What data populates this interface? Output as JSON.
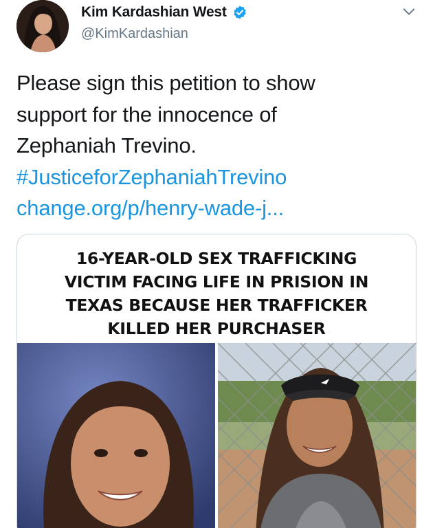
{
  "user": {
    "display_name": "Kim Kardashian West",
    "handle": "@KimKardashian",
    "verified": true,
    "avatar_icon": "profile-photo"
  },
  "tweet": {
    "lines": [
      "Please sign this petition to show",
      "support for the innocence of",
      "Zephaniah Trevino."
    ],
    "hashtag": "#JusticeforZephaniahTrevino",
    "link": "change.org/p/henry-wade-j..."
  },
  "card": {
    "headline_lines": [
      "16-YEAR-OLD SEX TRAFFICKING",
      "VICTIM FACING LIFE IN PRISION IN",
      "TEXAS BECAUSE HER TRAFFICKER",
      "KILLED HER PURCHASER"
    ],
    "left_photo": "school-portrait-photo",
    "right_photo": "softball-field-photo"
  },
  "colors": {
    "link": "#1b95e0",
    "verified": "#1da1f2",
    "handle": "#657786",
    "text": "#14171a"
  }
}
